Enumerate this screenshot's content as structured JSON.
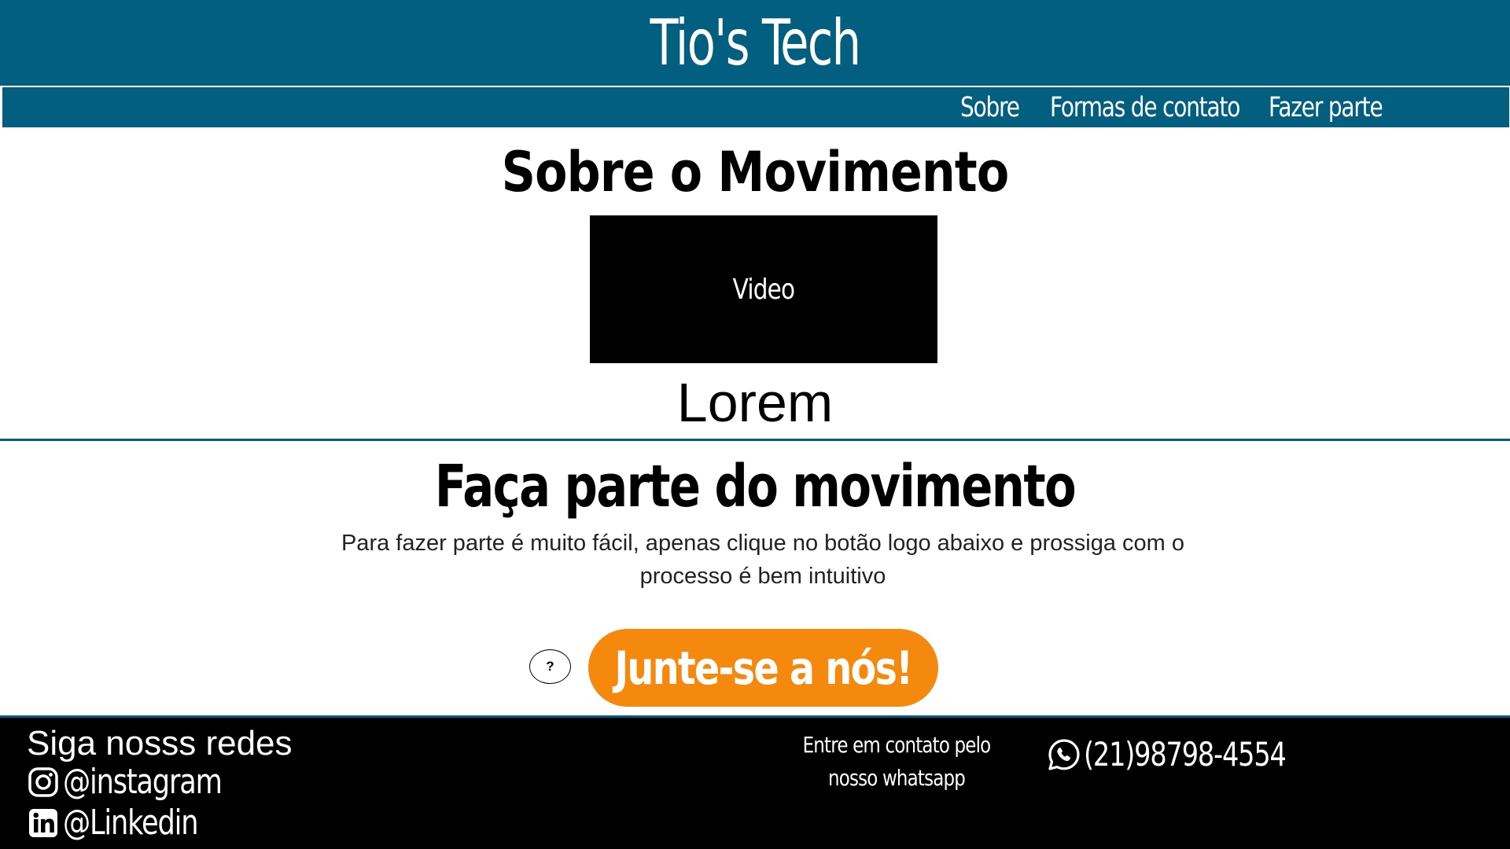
{
  "header": {
    "site_title": "Tio's Tech",
    "nav": [
      {
        "label": "Sobre"
      },
      {
        "label": "Formas de contato"
      },
      {
        "label": "Fazer parte"
      }
    ]
  },
  "about": {
    "title": "Sobre o Movimento",
    "video_label": "Video",
    "text": "Lorem"
  },
  "join": {
    "title": "Faça parte do movimento",
    "description": "Para fazer parte é muito fácil, apenas clique no botão logo abaixo e prossiga com o processo é bem intuitivo",
    "help_label": "?",
    "button_label": "Junte-se a nós!"
  },
  "footer": {
    "social_heading": "Siga nosss redes",
    "instagram": "@instagram",
    "linkedin": "@Linkedin",
    "whatsapp_text": "Entre em contato pelo nosso whatsapp",
    "whatsapp_number": "(21)98798-4554"
  },
  "colors": {
    "primary": "#025f7f",
    "accent": "#f4890e",
    "footer_bg": "#000000"
  },
  "icons": {
    "instagram": "instagram-icon",
    "linkedin": "linkedin-icon",
    "whatsapp": "whatsapp-icon"
  }
}
